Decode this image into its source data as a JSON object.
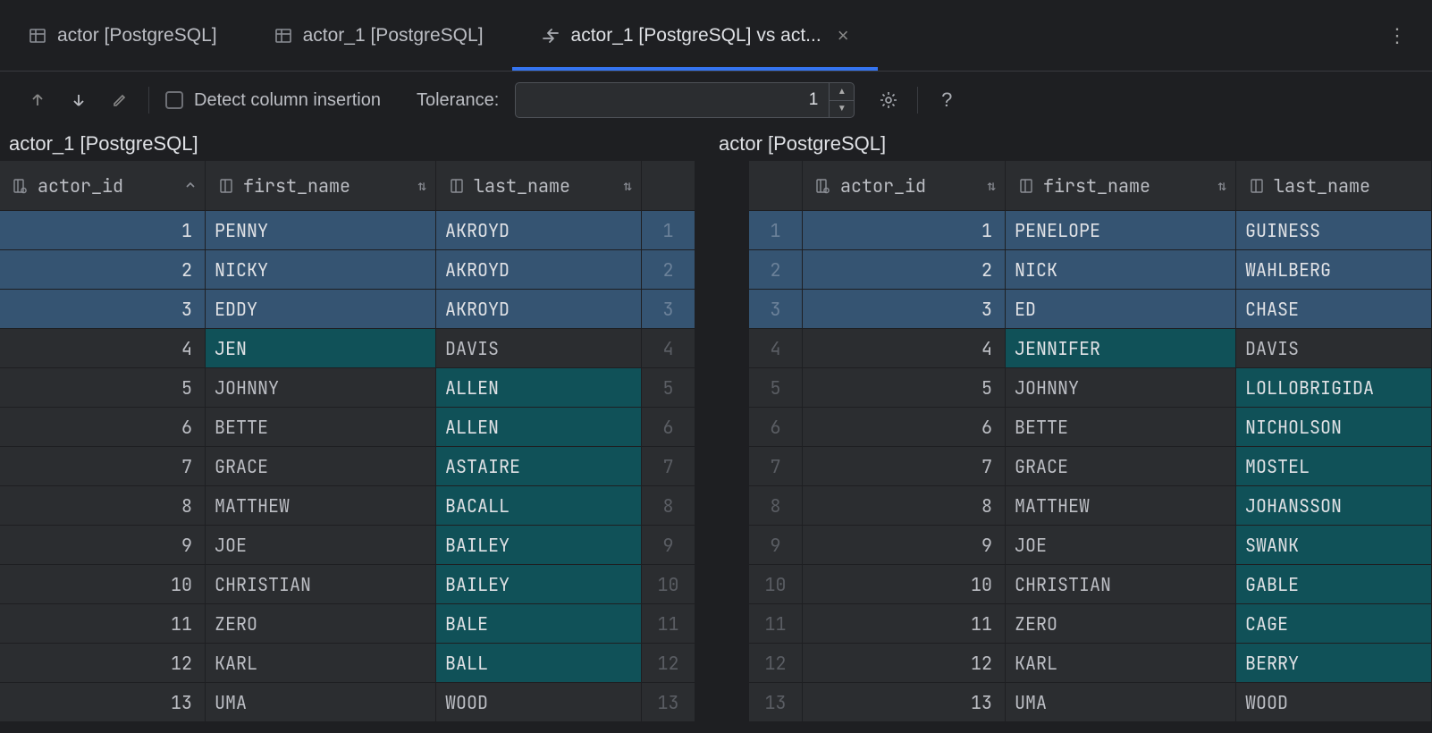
{
  "tabs": [
    {
      "label": "actor [PostgreSQL]",
      "icon": "table"
    },
    {
      "label": "actor_1 [PostgreSQL]",
      "icon": "table"
    },
    {
      "label": "actor_1 [PostgreSQL] vs act...",
      "icon": "diff",
      "active": true,
      "closable": true
    }
  ],
  "toolbar": {
    "checkbox_label": "Detect column insertion",
    "tolerance_label": "Tolerance:",
    "tolerance_value": "1"
  },
  "panels": {
    "left_title": "actor_1 [PostgreSQL]",
    "right_title": "actor [PostgreSQL]"
  },
  "headers": {
    "left": [
      {
        "name": "actor_id",
        "sort": "asc"
      },
      {
        "name": "first_name",
        "sort": "updown"
      },
      {
        "name": "last_name",
        "sort": "updown"
      }
    ],
    "right": [
      {
        "name": "actor_id",
        "sort": "updown"
      },
      {
        "name": "first_name",
        "sort": "updown"
      },
      {
        "name": "last_name",
        "sort": ""
      }
    ]
  },
  "rows": [
    {
      "id": 1,
      "l": [
        "PENNY",
        "AKROYD"
      ],
      "r": [
        "PENELOPE",
        "GUINESS"
      ],
      "diff": "row"
    },
    {
      "id": 2,
      "l": [
        "NICKY",
        "AKROYD"
      ],
      "r": [
        "NICK",
        "WAHLBERG"
      ],
      "diff": "row"
    },
    {
      "id": 3,
      "l": [
        "EDDY",
        "AKROYD"
      ],
      "r": [
        "ED",
        "CHASE"
      ],
      "diff": "row"
    },
    {
      "id": 4,
      "l": [
        "JEN",
        "DAVIS"
      ],
      "r": [
        "JENNIFER",
        "DAVIS"
      ],
      "diff": "first"
    },
    {
      "id": 5,
      "l": [
        "JOHNNY",
        "ALLEN"
      ],
      "r": [
        "JOHNNY",
        "LOLLOBRIGIDA"
      ],
      "diff": "last"
    },
    {
      "id": 6,
      "l": [
        "BETTE",
        "ALLEN"
      ],
      "r": [
        "BETTE",
        "NICHOLSON"
      ],
      "diff": "last"
    },
    {
      "id": 7,
      "l": [
        "GRACE",
        "ASTAIRE"
      ],
      "r": [
        "GRACE",
        "MOSTEL"
      ],
      "diff": "last"
    },
    {
      "id": 8,
      "l": [
        "MATTHEW",
        "BACALL"
      ],
      "r": [
        "MATTHEW",
        "JOHANSSON"
      ],
      "diff": "last"
    },
    {
      "id": 9,
      "l": [
        "JOE",
        "BAILEY"
      ],
      "r": [
        "JOE",
        "SWANK"
      ],
      "diff": "last"
    },
    {
      "id": 10,
      "l": [
        "CHRISTIAN",
        "BAILEY"
      ],
      "r": [
        "CHRISTIAN",
        "GABLE"
      ],
      "diff": "last"
    },
    {
      "id": 11,
      "l": [
        "ZERO",
        "BALE"
      ],
      "r": [
        "ZERO",
        "CAGE"
      ],
      "diff": "last"
    },
    {
      "id": 12,
      "l": [
        "KARL",
        "BALL"
      ],
      "r": [
        "KARL",
        "BERRY"
      ],
      "diff": "last"
    },
    {
      "id": 13,
      "l": [
        "UMA",
        "WOOD"
      ],
      "r": [
        "UMA",
        "WOOD"
      ],
      "diff": "none"
    }
  ]
}
